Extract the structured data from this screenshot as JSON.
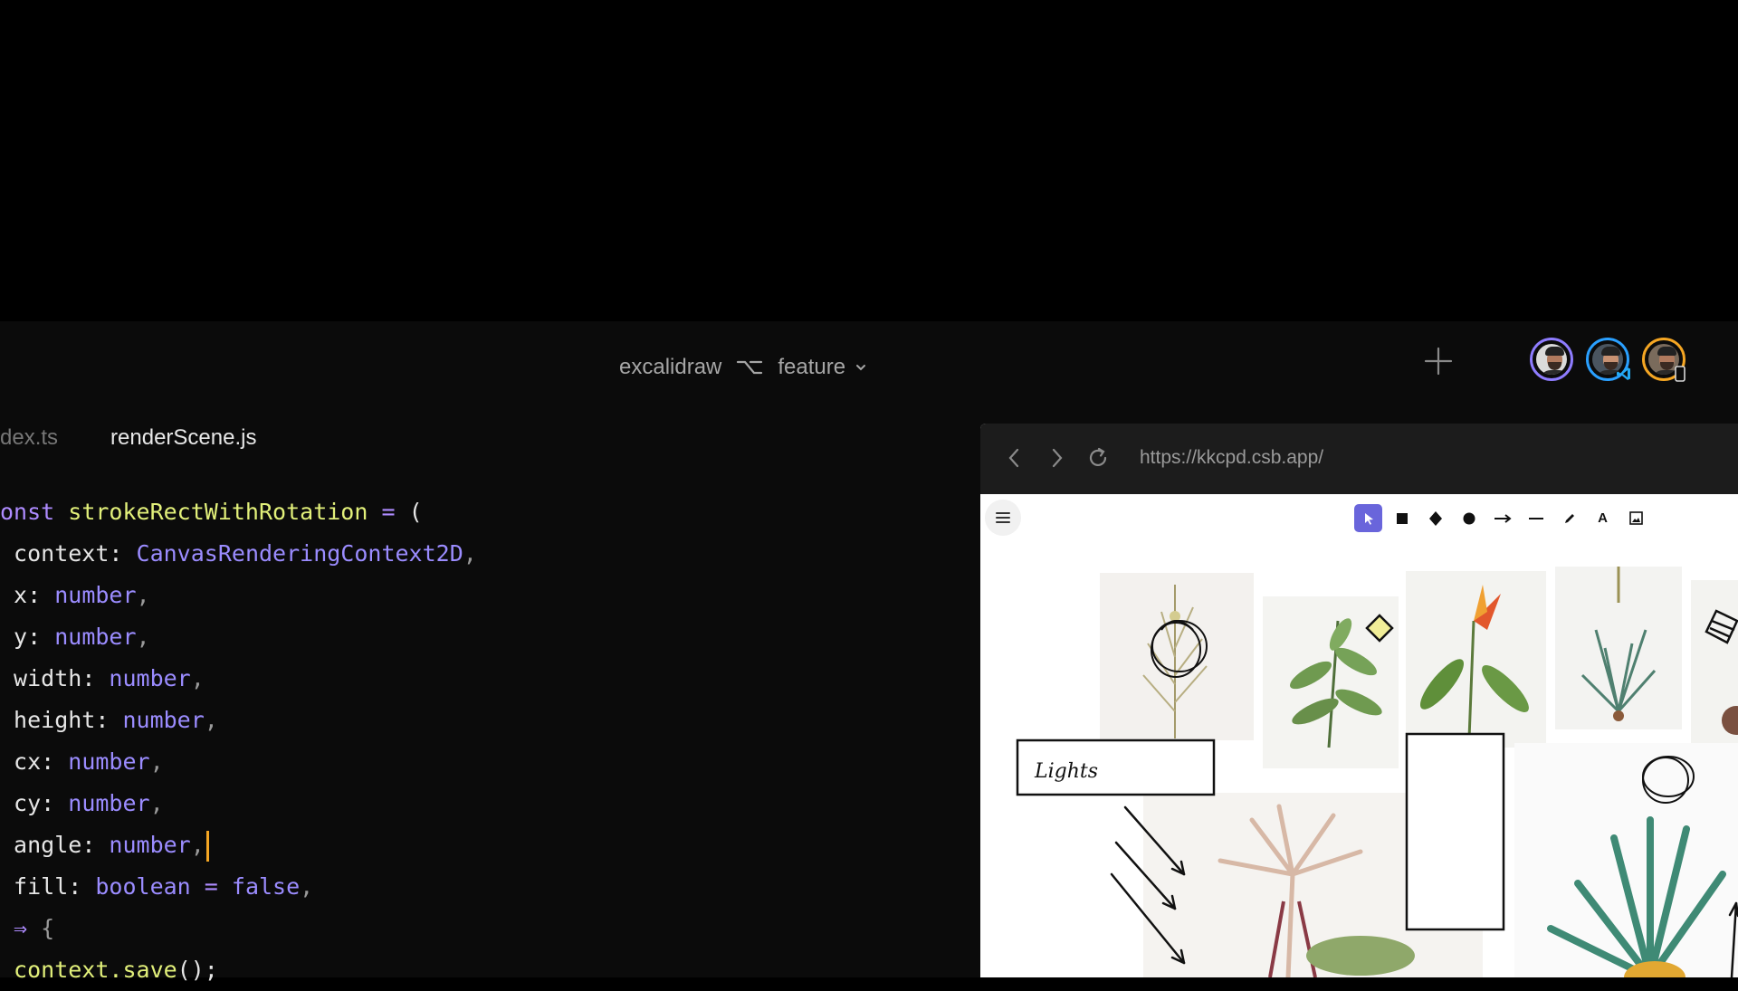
{
  "header": {
    "project": "excalidraw",
    "branch": "feature",
    "icons": {
      "branch": "git-branch-icon",
      "chevron": "chevron-down-icon",
      "plus": "plus-icon"
    },
    "avatars": [
      {
        "name": "avatar-user-1",
        "ring": "#8e7cff"
      },
      {
        "name": "avatar-user-2",
        "ring": "#2aa0ff",
        "badge": "vscode-icon"
      },
      {
        "name": "avatar-user-3",
        "ring": "#f5a623",
        "badge": "mobile-device-icon"
      }
    ]
  },
  "editor": {
    "tabs": [
      {
        "label": "dex.ts",
        "active": false
      },
      {
        "label": "renderScene.js",
        "active": true
      }
    ],
    "lines": [
      {
        "parts": [
          {
            "t": "onst ",
            "c": "kw"
          },
          {
            "t": "strokeRectWithRotation",
            "c": "fn"
          },
          {
            "t": " = ",
            "c": "kw"
          },
          {
            "t": "(",
            "c": ""
          }
        ]
      },
      {
        "parts": [
          {
            "t": " context",
            "c": ""
          },
          {
            "t": ": ",
            "c": ""
          },
          {
            "t": "CanvasRenderingContext2D",
            "c": "ty"
          },
          {
            "t": ",",
            "c": "pu"
          }
        ]
      },
      {
        "parts": [
          {
            "t": " x",
            "c": ""
          },
          {
            "t": ": ",
            "c": ""
          },
          {
            "t": "number",
            "c": "ty"
          },
          {
            "t": ",",
            "c": "pu"
          }
        ]
      },
      {
        "parts": [
          {
            "t": " y",
            "c": ""
          },
          {
            "t": ": ",
            "c": ""
          },
          {
            "t": "number",
            "c": "ty"
          },
          {
            "t": ",",
            "c": "pu"
          }
        ]
      },
      {
        "parts": [
          {
            "t": " width",
            "c": ""
          },
          {
            "t": ": ",
            "c": ""
          },
          {
            "t": "number",
            "c": "ty"
          },
          {
            "t": ",",
            "c": "pu"
          }
        ]
      },
      {
        "parts": [
          {
            "t": " height",
            "c": ""
          },
          {
            "t": ": ",
            "c": ""
          },
          {
            "t": "number",
            "c": "ty"
          },
          {
            "t": ",",
            "c": "pu"
          }
        ]
      },
      {
        "parts": [
          {
            "t": " cx",
            "c": ""
          },
          {
            "t": ": ",
            "c": ""
          },
          {
            "t": "number",
            "c": "ty"
          },
          {
            "t": ",",
            "c": "pu"
          }
        ]
      },
      {
        "parts": [
          {
            "t": " cy",
            "c": ""
          },
          {
            "t": ": ",
            "c": ""
          },
          {
            "t": "number",
            "c": "ty"
          },
          {
            "t": ",",
            "c": "pu"
          }
        ]
      },
      {
        "parts": [
          {
            "t": " angle",
            "c": ""
          },
          {
            "t": ": ",
            "c": ""
          },
          {
            "t": "number",
            "c": "ty"
          },
          {
            "t": ",",
            "c": "pu"
          }
        ],
        "cursor": true
      },
      {
        "parts": [
          {
            "t": " fill",
            "c": ""
          },
          {
            "t": ": ",
            "c": ""
          },
          {
            "t": "boolean",
            "c": "ty"
          },
          {
            "t": " = ",
            "c": "kw"
          },
          {
            "t": "false",
            "c": "ty"
          },
          {
            "t": ",",
            "c": "pu"
          }
        ]
      },
      {
        "parts": [
          {
            "t": " ⇒",
            "c": "kw"
          },
          {
            "t": " {",
            "c": "pu"
          }
        ]
      },
      {
        "parts": [
          {
            "t": " context.save",
            "c": "fn"
          },
          {
            "t": "();",
            "c": ""
          }
        ]
      }
    ]
  },
  "preview": {
    "url": "https://kkcpd.csb.app/",
    "icons": {
      "back": "back-arrow-icon",
      "forward": "forward-arrow-icon",
      "reload": "reload-icon",
      "menu": "hamburger-menu-icon"
    },
    "tools": [
      "selection-tool-icon",
      "rectangle-tool-icon",
      "diamond-tool-icon",
      "ellipse-tool-icon",
      "arrow-tool-icon",
      "line-tool-icon",
      "draw-tool-icon",
      "text-tool-icon",
      "image-tool-icon"
    ],
    "text_tool_glyph": "A",
    "canvas_label": "Lights"
  }
}
